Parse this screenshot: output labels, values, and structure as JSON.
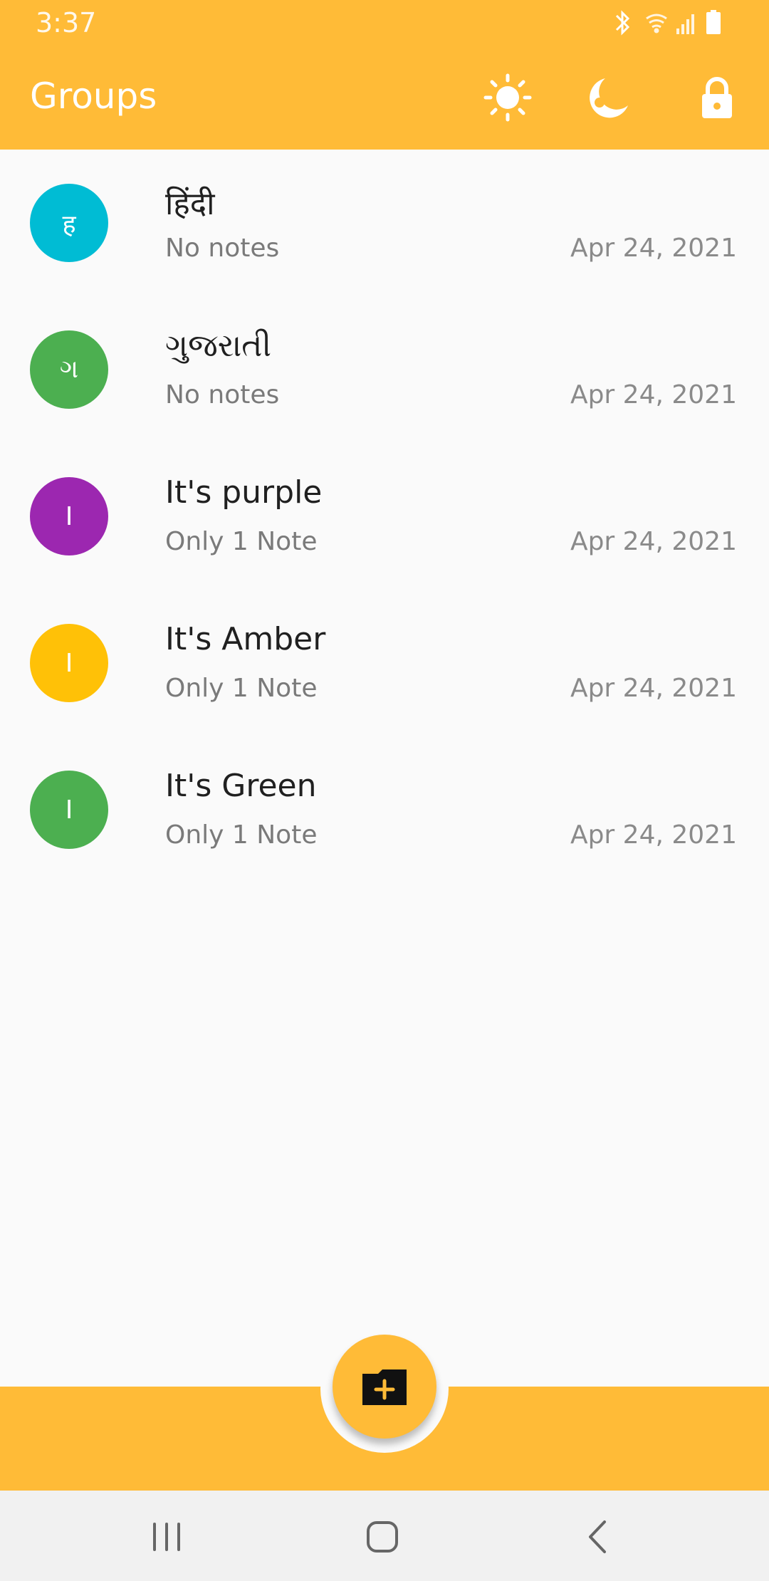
{
  "status_bar": {
    "time": "3:37",
    "icons": [
      "bluetooth-icon",
      "wifi-icon",
      "signal-icon",
      "battery-icon"
    ]
  },
  "app_bar": {
    "title": "Groups",
    "actions": [
      "light-theme-icon",
      "dark-theme-icon",
      "lock-icon"
    ]
  },
  "colors": {
    "primary": "#ffbb37",
    "background": "#fafafa",
    "avatar_cyan": "#00bcd4",
    "avatar_green": "#4caf50",
    "avatar_purple": "#9c27b0",
    "avatar_amber": "#ffc107"
  },
  "groups": [
    {
      "initial": "ह",
      "title": "हिंदी",
      "subtitle": "No notes",
      "date": "Apr 24, 2021",
      "color": "#00bcd4"
    },
    {
      "initial": "ગ",
      "title": "ગુજરાતી",
      "subtitle": "No notes",
      "date": "Apr 24, 2021",
      "color": "#4caf50"
    },
    {
      "initial": "I",
      "title": "It's purple",
      "subtitle": "Only 1 Note",
      "date": "Apr 24, 2021",
      "color": "#9c27b0"
    },
    {
      "initial": "I",
      "title": "It's Amber",
      "subtitle": "Only 1 Note",
      "date": "Apr 24, 2021",
      "color": "#ffc107"
    },
    {
      "initial": "I",
      "title": "It's Green",
      "subtitle": "Only 1 Note",
      "date": "Apr 24, 2021",
      "color": "#4caf50"
    }
  ],
  "fab": {
    "icon": "add-folder-icon"
  },
  "nav_bar": {
    "buttons": [
      "recents-icon",
      "home-icon",
      "back-icon"
    ]
  }
}
